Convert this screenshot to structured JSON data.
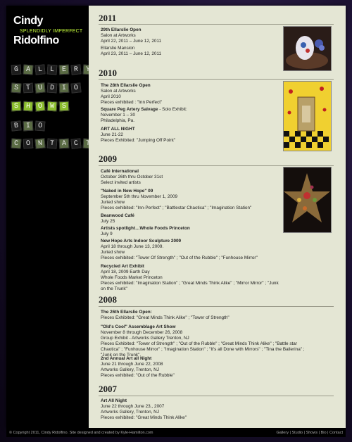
{
  "logo": {
    "first": "Cindy",
    "tagline": "SPLENDIDLY IMPERFECT",
    "last": "Ridolfino"
  },
  "nav": [
    {
      "label": "GALLERY",
      "letters": [
        "G",
        "A",
        "L",
        "L",
        "E",
        "R",
        "Y"
      ]
    },
    {
      "label": "STUDIO",
      "letters": [
        "S",
        "T",
        "U",
        "D",
        "I",
        "O"
      ]
    },
    {
      "label": "SHOWS",
      "letters": [
        "S",
        "H",
        "O",
        "W",
        "S"
      ]
    },
    {
      "label": "BIO",
      "letters": [
        "B",
        "I",
        "O"
      ]
    },
    {
      "label": "CONTACT",
      "letters": [
        "C",
        "O",
        "N",
        "T",
        "A",
        "C",
        "T"
      ]
    }
  ],
  "years": [
    "2011",
    "2010",
    "2009",
    "2008",
    "2007"
  ],
  "entries": {
    "e2011a": {
      "title": "29th Ellarslie Open",
      "lines": [
        "Salon at Artworks",
        "April 22, 2011 – June 12, 2011"
      ]
    },
    "e2011b": {
      "lines": [
        "Ellarslie Mansion",
        "April 23, 2011 – June 12, 2011"
      ]
    },
    "e2010a": {
      "title": "The 28th Ellarslie Open",
      "lines": [
        "Salon at Artworks",
        "April 2010",
        "Pieces exhibited : \"Inn Perfect\""
      ]
    },
    "e2010b": {
      "title": "Square Peg Artery Salvage",
      "title_suffix": " - Solo Exhibit:",
      "lines": [
        "November 1 – 30",
        "Philadelphia, Pa."
      ]
    },
    "e2010c": {
      "title": "ART ALL NIGHT",
      "lines": [
        "June 21-22",
        "Pieces Exhibited:  \"Jumping Off Point\""
      ]
    },
    "e2009a": {
      "title": "Café International",
      "lines": [
        "October 26th thru October 31st",
        "Select invited artists"
      ]
    },
    "e2009b": {
      "title": "\"Naked in New Hope\" 09",
      "lines": [
        "September 5th thru November 1, 2009",
        "Juried show",
        "Pieces exhibited:  \"Inn-Perfect\" ;  \"Battlestar Chaotica\" ;  \"Imagination Station\""
      ]
    },
    "e2009c": {
      "title": "Beanwood Café",
      "lines": [
        "July 25"
      ]
    },
    "e2009d": {
      "title": "Artists spotlight…Whole Foods Princeton",
      "lines": [
        "July 9"
      ]
    },
    "e2009e": {
      "title": "New Hope Arts Indoor Sculpture 2009",
      "lines": [
        "April 18 through June 13, 2009.",
        "Juried show",
        "Pieces exhibited:  \"Tower Of Strength\" ;  \"Out of the Rubble\" ;  \"Funhouse Mirror\""
      ]
    },
    "e2009f": {
      "title": "Recycled Art Exhibit",
      "lines": [
        "April 18, 2009   Earth Day",
        "Whole Foods Market Princeton",
        "Pieces exhibited:  \"Imagination Station\" ;  \"Great Minds Think Alike\" ; \"Mirror Mirror\" ;  \"Junk on the Trunk\""
      ]
    },
    "e2008a": {
      "title": "The 26th Ellarslie Open:",
      "lines": [
        "Pieces Exhibited: \"Great Minds Think Alike\" ; \"Tower of Strength\""
      ]
    },
    "e2008b": {
      "title": "\"Old's Cool\"  Assemblage Art Show",
      "lines": [
        "November 8 through December 26, 2008",
        "Group Exhibit - Artworks Gallery   Trenton, NJ",
        "Pieces Exhibited: \"Tower of Strength\" ; \"Out of the Rubble\" ; \"Great Minds Think Alike\" ;  \"Battle star Chaotica\" ;  \"Funhouse Mirror\" ;  \"Imagination Station\" ;  \"It's all Done with Mirrors\" ;  \"Tina the Ballerina\" ;  \"Junk on the Trunk\"."
      ]
    },
    "e2008c": {
      "title": "2nd Annual Art all Night",
      "lines": [
        "June 21 through June 22, 2008",
        "Artworks Gallery, Trenton, NJ",
        "Pieces exhibited:  \"Out of the Rubble\""
      ]
    },
    "e2007a": {
      "title": "Art All Night",
      "lines": [
        "June 22 through June 23,, 2007",
        "Artworks Gallery,  Trenton, NJ",
        "Pieces exhibited:  \"Great Minds Think Alike\""
      ]
    }
  },
  "footer": {
    "left": "© Copyright 2011, Cindy Ridolfino. Site designed and created by Kyle-Hamilton.com",
    "links": [
      "Gallery",
      "Studio",
      "Shows",
      "Bio",
      "Contact"
    ]
  },
  "colors": {
    "accent": "#c8ff3c",
    "active_tile": "#8bbd2e",
    "content_bg": "#e4e6d4"
  }
}
